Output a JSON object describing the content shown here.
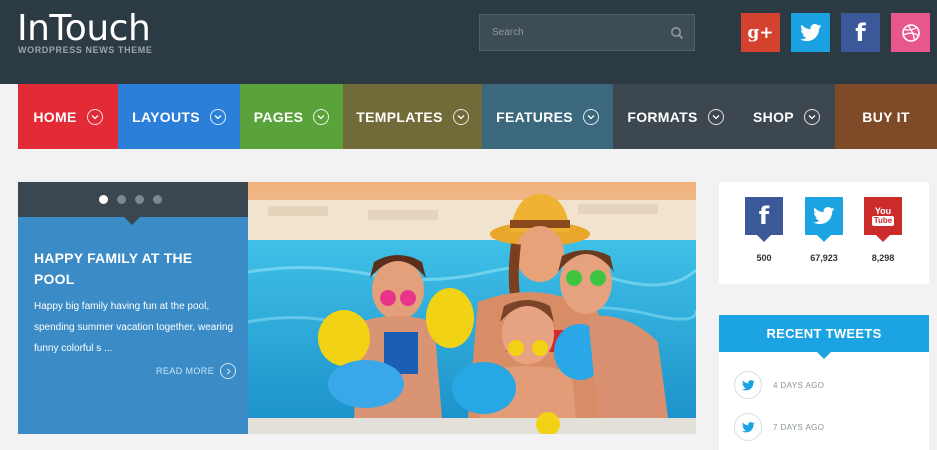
{
  "brand": {
    "title": "InTouch",
    "subtitle": "WORDPRESS NEWS THEME"
  },
  "search": {
    "placeholder": "Search",
    "icon": "search-icon"
  },
  "social_links": [
    {
      "name": "google-plus",
      "label": "g+",
      "color": "#d3422e"
    },
    {
      "name": "twitter",
      "color": "#1ba0e1"
    },
    {
      "name": "facebook",
      "label": "f",
      "color": "#3b5998"
    },
    {
      "name": "dribbble",
      "color": "#e8578c"
    }
  ],
  "nav": {
    "items": [
      {
        "label": "HOME",
        "color": "#e32b37",
        "has_dropdown": true
      },
      {
        "label": "LAYOUTS",
        "color": "#2b7fd9",
        "has_dropdown": true
      },
      {
        "label": "PAGES",
        "color": "#5aa33a",
        "has_dropdown": true
      },
      {
        "label": "TEMPLATES",
        "color": "#706b38",
        "has_dropdown": true
      },
      {
        "label": "FEATURES",
        "color": "#3b687d",
        "has_dropdown": true
      },
      {
        "label": "FORMATS",
        "color": "#3c474f",
        "has_dropdown": true
      },
      {
        "label": "SHOP",
        "color": "#3c474f",
        "has_dropdown": true
      },
      {
        "label": "BUY IT",
        "color": "#7f4a28",
        "has_dropdown": false
      }
    ]
  },
  "slider": {
    "dots_total": 4,
    "active_dot": 1,
    "title": "HAPPY FAMILY AT THE POOL",
    "excerpt": "Happy big family having fun at the pool, spending summer vacation together, wearing funny colorful s ...",
    "read_more": "READ MORE"
  },
  "social_counts": [
    {
      "network": "facebook",
      "count": "500",
      "color": "#3b5998"
    },
    {
      "network": "twitter",
      "count": "67,923",
      "color": "#1ca3e1"
    },
    {
      "network": "youtube",
      "label_top": "You",
      "label_bottom": "Tube",
      "count": "8,298",
      "color": "#cc2b2b"
    }
  ],
  "recent_tweets": {
    "title": "RECENT TWEETS",
    "items": [
      {
        "time": "4 DAYS AGO"
      },
      {
        "time": "7 DAYS AGO"
      }
    ]
  }
}
